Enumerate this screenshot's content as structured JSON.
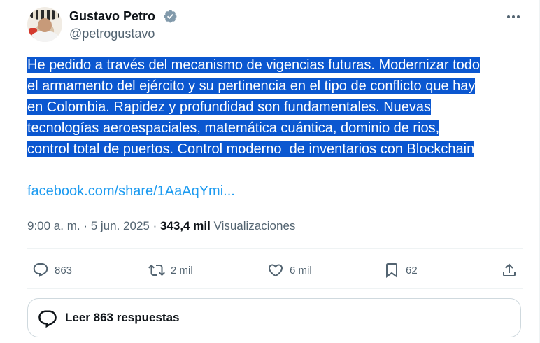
{
  "author": {
    "name": "Gustavo Petro",
    "handle": "@petrogustavo"
  },
  "tweet": {
    "lines": [
      "He pedido a través del mecanismo de vigencias futuras. Modernizar todo",
      "el armamento del ejército y su pertinencia en el tipo de conflicto que hay",
      "en Colombia. Rapidez y profundidad son fundamentales. Nuevas",
      "tecnologías aeroespaciales, matemática cuántica, dominio de rios,",
      "control total de puertos. Control moderno  de inventarios con Blockchain"
    ],
    "link": "facebook.com/share/1AaAqYmi..."
  },
  "meta": {
    "time": "9:00 a. m.",
    "date": "5 jun. 2025",
    "views": "343,4 mil",
    "views_label": "Visualizaciones"
  },
  "actions": {
    "replies": "863",
    "reposts": "2 mil",
    "likes": "6 mil",
    "bookmarks": "62"
  },
  "read_replies": {
    "label": "Leer 863 respuestas"
  },
  "colors": {
    "accent": "#1d9bf0",
    "selection": "#0b57d0",
    "secondary_text": "#536471"
  },
  "icons": [
    "verified-badge-icon",
    "more-icon",
    "reply-icon",
    "repost-icon",
    "like-icon",
    "bookmark-icon",
    "share-icon",
    "speech-bubble-icon"
  ]
}
